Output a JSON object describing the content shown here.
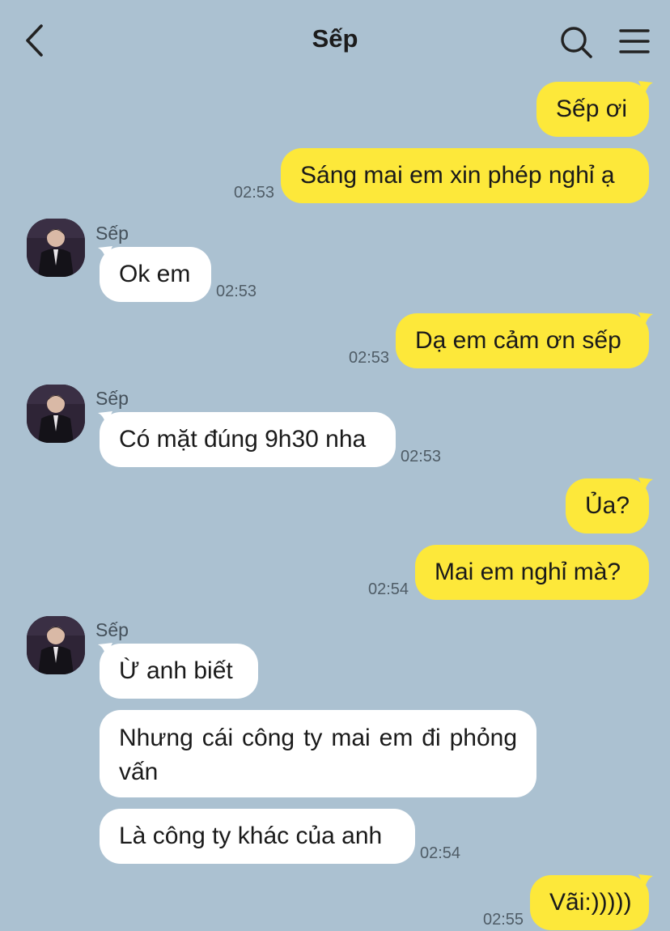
{
  "header": {
    "title": "Sếp"
  },
  "messages": {
    "m1": {
      "text": "Sếp ơi"
    },
    "m2": {
      "text": "Sáng mai em xin phép nghỉ ạ",
      "time": "02:53"
    },
    "m3": {
      "sender": "Sếp",
      "text": "Ok em",
      "time": "02:53"
    },
    "m4": {
      "text": "Dạ em cảm ơn sếp",
      "time": "02:53"
    },
    "m5": {
      "sender": "Sếp",
      "text": "Có mặt đúng 9h30 nha",
      "time": "02:53"
    },
    "m6": {
      "text": "Ủa?"
    },
    "m7": {
      "text": "Mai em nghỉ mà?",
      "time": "02:54"
    },
    "m8": {
      "sender": "Sếp",
      "text": "Ừ anh biết"
    },
    "m9": {
      "text": "Nhưng cái công ty mai em đi phỏng vấn"
    },
    "m10": {
      "text": "Là công ty khác của anh",
      "time": "02:54"
    },
    "m11": {
      "text": "Vãi:)))))",
      "time": "02:55"
    }
  },
  "colors": {
    "background": "#abc1d1",
    "outgoing_bubble": "#fde83a",
    "incoming_bubble": "#ffffff"
  }
}
